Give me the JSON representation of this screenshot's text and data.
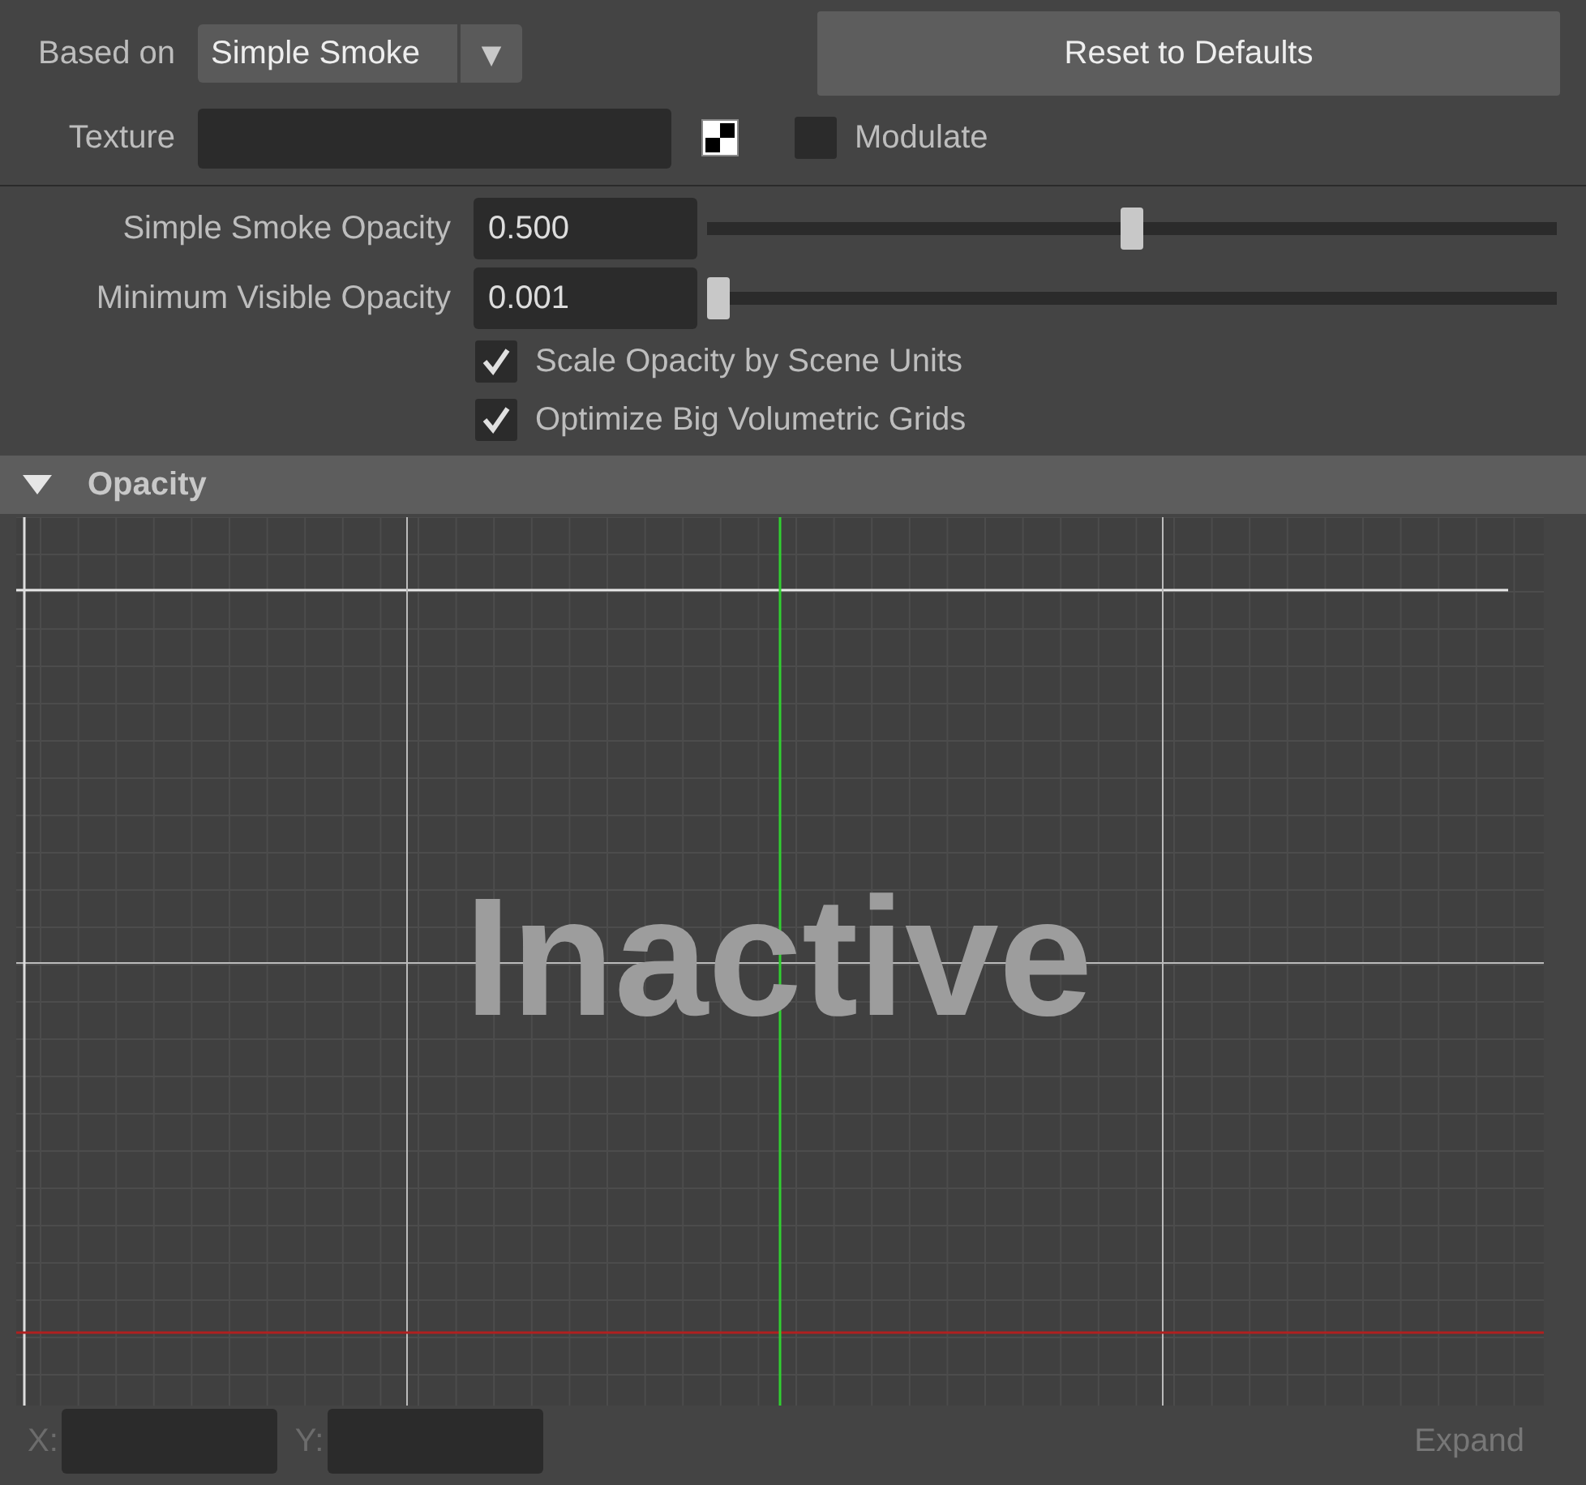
{
  "based_on": {
    "label": "Based on",
    "value": "Simple Smoke",
    "arrow": "▼"
  },
  "reset_button": {
    "label": "Reset to Defaults"
  },
  "texture": {
    "label": "Texture"
  },
  "modulate": {
    "label": "Modulate",
    "checked": false
  },
  "sliders": [
    {
      "label": "Simple Smoke Opacity",
      "value": "0.500",
      "level": 0.5
    },
    {
      "label": "Minimum Visible Opacity",
      "value": "0.001",
      "level": 0.0
    }
  ],
  "checkboxes": [
    {
      "label": "Scale Opacity by Scene Units",
      "checked": true
    },
    {
      "label": "Optimize Big Volumetric Grids",
      "checked": true
    }
  ],
  "section": {
    "title": "Opacity",
    "expanded": true
  },
  "graph": {
    "overlay_text": "Inactive"
  },
  "coords": [
    {
      "label": "X:"
    },
    {
      "label": "Y:"
    }
  ],
  "expand_button": {
    "label": "Expand",
    "disabled": true
  }
}
